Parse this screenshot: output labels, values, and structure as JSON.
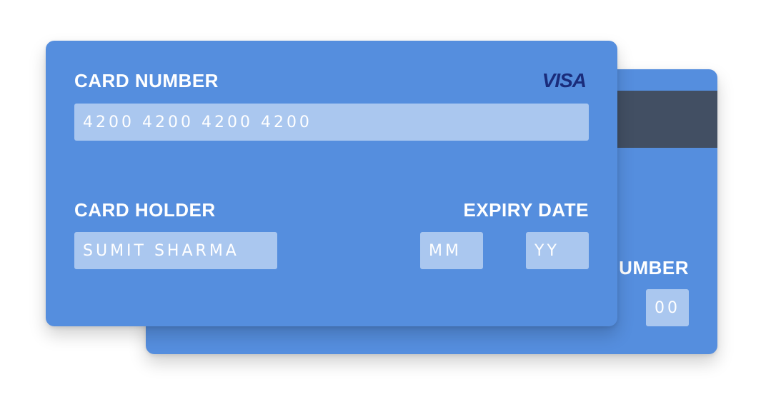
{
  "colors": {
    "card": "#558ede",
    "stripe": "#424f63",
    "visa": "#1a2c7b",
    "label": "#ffffff"
  },
  "front": {
    "card_number_label": "CARD NUMBER",
    "brand": "VISA",
    "card_number_placeholder": "4200 4200 4200 4200",
    "holder_label": "CARD HOLDER",
    "holder_placeholder": "SUMIT SHARMA",
    "expiry_label": "EXPIRY DATE",
    "month_placeholder": "MM",
    "year_placeholder": "YY"
  },
  "back": {
    "cvv_label": "CVV NUMBER",
    "cvv_placeholder": "00"
  }
}
